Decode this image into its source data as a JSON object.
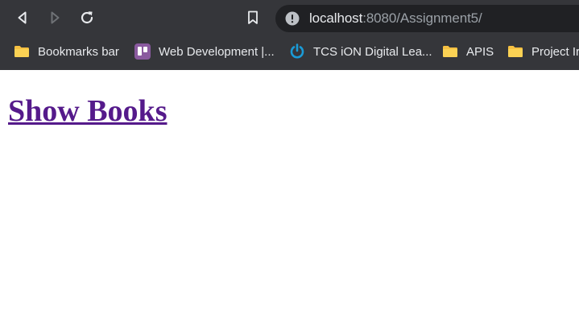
{
  "browser": {
    "toolbar": {
      "back_icon": "back-arrow-icon",
      "forward_icon": "forward-arrow-icon",
      "reload_icon": "reload-icon",
      "bookmark_icon": "bookmark-icon"
    },
    "address_bar": {
      "info_icon": "info-icon",
      "host": "localhost",
      "path": ":8080/Assignment5/"
    },
    "bookmarks": [
      {
        "label": "Bookmarks bar",
        "icon": "folder-icon"
      },
      {
        "label": "Web Development |...",
        "icon": "trello-icon"
      },
      {
        "label": "TCS iON Digital Lea...",
        "icon": "tcs-ion-power-icon"
      },
      {
        "label": "APIS",
        "icon": "folder-icon"
      },
      {
        "label": "Project Ir",
        "icon": "folder-icon"
      }
    ]
  },
  "page": {
    "heading_link": "Show Books"
  },
  "colors": {
    "chrome_bg": "#35363a",
    "omnibox_bg": "#202124",
    "link_visited": "#551a8b",
    "folder": "#f6c042",
    "trello": "#8a5a9f",
    "tcs_blue": "#1a9bd7"
  }
}
